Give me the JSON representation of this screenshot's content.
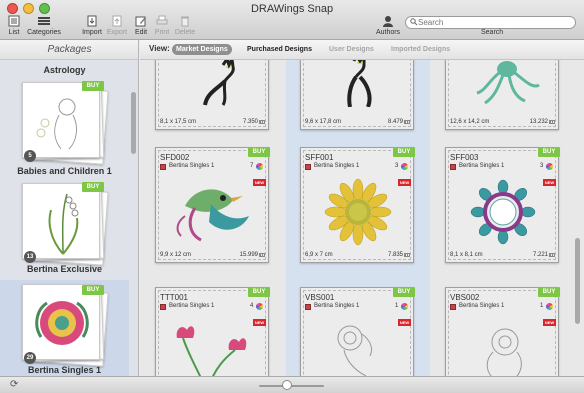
{
  "app": {
    "title": "DRAWings Snap"
  },
  "toolbar": {
    "list": "List",
    "categories": "Categories",
    "import": "Import",
    "export": "Export",
    "edit": "Edit",
    "print": "Print",
    "delete": "Delete",
    "authors": "Authors",
    "search_placeholder": "Search",
    "search_label": "Search"
  },
  "sidebar": {
    "header": "Packages",
    "packages": [
      {
        "name": "Astrology"
      },
      {
        "name": "Babies and Children 1",
        "buy": "BUY",
        "count": "5"
      },
      {
        "name": "Bertina Exclusive",
        "buy": "BUY",
        "count": "13"
      },
      {
        "name": "Bertina Singles 1",
        "buy": "BUY",
        "count": "29",
        "selected": true
      }
    ]
  },
  "view": {
    "label": "View:",
    "tabs": [
      {
        "label": "Market Designs",
        "state": "active"
      },
      {
        "label": "Purchased Designs",
        "state": "normal"
      },
      {
        "label": "User Designs",
        "state": "disabled"
      },
      {
        "label": "Imported Designs",
        "state": "disabled"
      }
    ]
  },
  "designs": [
    {
      "size": "8,1 x 17,5 cm",
      "stitches": "7.350",
      "art": "cat"
    },
    {
      "size": "9,6 x 17,8 cm",
      "stitches": "8.479",
      "art": "cat"
    },
    {
      "size": "12,6 x 14,2 cm",
      "stitches": "13.232",
      "art": "octopus"
    },
    {
      "code": "SFD002",
      "package": "Bertina Singles 1",
      "colors": "7",
      "buy": "BUY",
      "new": "NEW",
      "size": "9,9 x 12 cm",
      "stitches": "15.999",
      "art": "bird"
    },
    {
      "code": "SFF001",
      "package": "Bertina Singles 1",
      "colors": "3",
      "buy": "BUY",
      "new": "NEW",
      "size": "6,9 x 7 cm",
      "stitches": "7.835",
      "art": "sunflower"
    },
    {
      "code": "SFF003",
      "package": "Bertina Singles 1",
      "colors": "3",
      "buy": "BUY",
      "new": "NEW",
      "size": "8,1 x 8,1 cm",
      "stitches": "7.221",
      "art": "wreath"
    },
    {
      "code": "TTT001",
      "package": "Bertina Singles 1",
      "colors": "4",
      "buy": "BUY",
      "new": "NEW",
      "art": "tulips"
    },
    {
      "code": "VBS001",
      "package": "Bertina Singles 1",
      "colors": "1",
      "buy": "BUY",
      "new": "NEW",
      "art": "rose"
    },
    {
      "code": "VBS002",
      "package": "Bertina Singles 1",
      "colors": "1",
      "buy": "BUY",
      "new": "NEW",
      "art": "rose"
    }
  ],
  "colors": {
    "buy_green": "#7ec646",
    "new_red": "#d9262c",
    "selection_blue": "#ccd8ea"
  }
}
